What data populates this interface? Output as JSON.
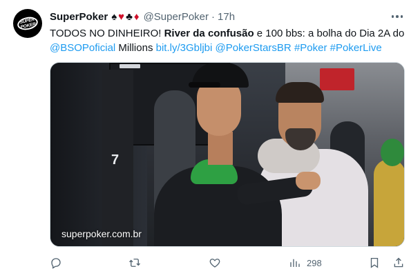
{
  "tweet": {
    "avatar_alt": "SUPER POKER",
    "display_name": "SuperPoker",
    "suits": [
      "♠",
      "♥",
      "♣",
      "♦"
    ],
    "handle": "@SuperPoker",
    "separator": "·",
    "time": "17h",
    "text": {
      "part1": "TODOS NO DINHEIRO! ",
      "bold1": "River da confusão",
      "part2": " e 100 bbs: a bolha do Dia 2A do",
      "mention": "@BSOPoficial",
      "part3": " Millions ",
      "url": "bit.ly/3Gbljbi",
      "mention2": "@PokerStarsBR",
      "hashtag1": "#Poker",
      "hashtag2": "#PokerLive"
    },
    "media": {
      "watermark": "superpoker.com.br",
      "number_on_pillar": "7"
    },
    "actions": {
      "views": "298"
    }
  },
  "icons": {
    "more": "more-horizontal-icon",
    "reply": "reply-icon",
    "retweet": "retweet-icon",
    "like": "like-icon",
    "views": "views-icon",
    "bookmark": "bookmark-icon",
    "share": "share-icon"
  },
  "colors": {
    "link": "#1d9bf0",
    "secondary_text": "#536471",
    "suit_red": "#d0112b",
    "text": "#0f1419"
  }
}
